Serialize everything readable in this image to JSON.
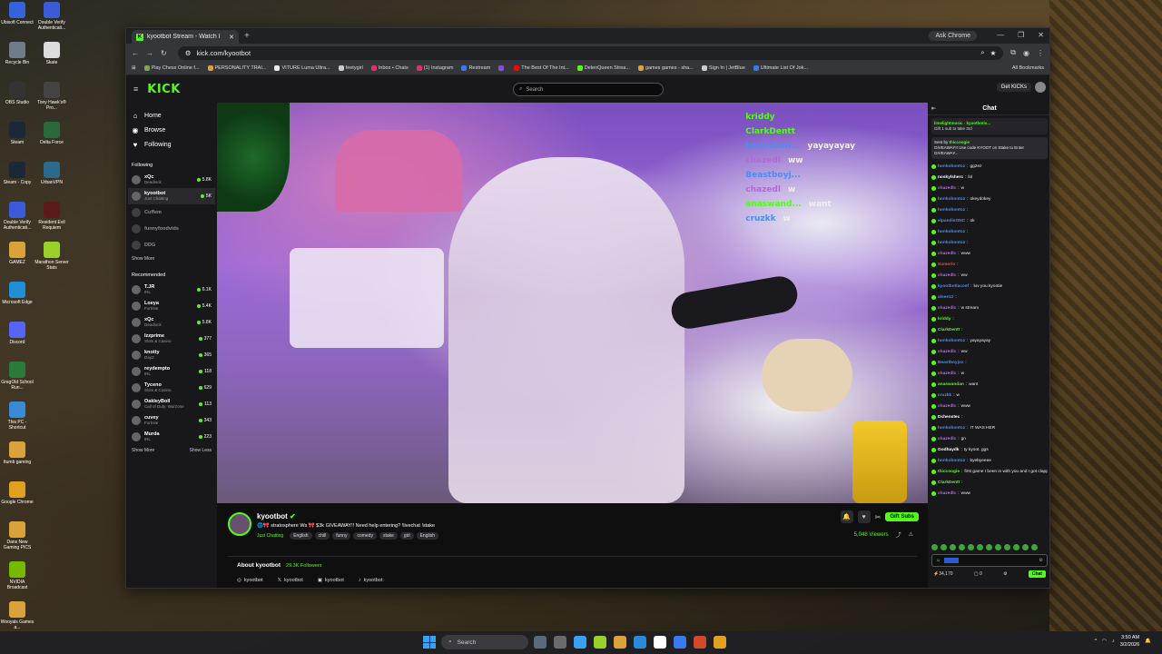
{
  "desktop": {
    "left_icons": [
      {
        "label": "Ubisoft Connect",
        "color": "#3563d9"
      },
      {
        "label": "Recycle Bin",
        "color": "#6f7c8a"
      },
      {
        "label": "OBS Studio",
        "color": "#333333"
      },
      {
        "label": "Steam",
        "color": "#1b2838"
      },
      {
        "label": "Steam - Copy",
        "color": "#1b2838"
      },
      {
        "label": "Double Verify Authenticati...",
        "color": "#3b5bd9"
      },
      {
        "label": "GAMEZ",
        "color": "#d9a23b"
      },
      {
        "label": "Microsoft Edge",
        "color": "#1f8fd8"
      },
      {
        "label": "Discord",
        "color": "#5865f2"
      },
      {
        "label": "GregOld School Run...",
        "color": "#2a7a3a"
      },
      {
        "label": "This PC - Shortcut",
        "color": "#3a8ad8"
      },
      {
        "label": "ttumb gaming",
        "color": "#d9a23b"
      },
      {
        "label": "Google Chrome",
        "color": "#e0a020"
      },
      {
        "label": "Dans New Gaming PICS",
        "color": "#d9a23b"
      },
      {
        "label": "NVIDIA Broadcast",
        "color": "#76b900"
      },
      {
        "label": "Wooyals Games a...",
        "color": "#d9a23b"
      }
    ],
    "right_icons": [
      {
        "label": "Double Verify Authenticati...",
        "color": "#3b5bd9"
      },
      {
        "label": "Skate",
        "color": "#dddddd"
      },
      {
        "label": "Tony Hawk's® Pro...",
        "color": "#444444"
      },
      {
        "label": "Delta Force",
        "color": "#2a6a3a"
      },
      {
        "label": "UrbanVPN",
        "color": "#2a6a8a"
      },
      {
        "label": "Resident Evil Requiem",
        "color": "#5a1a1a"
      },
      {
        "label": "Marathon Server Stats",
        "color": "#9ad02a"
      }
    ]
  },
  "browser": {
    "tab_title": "kyootbot Stream - Watch l",
    "ask_chrome": "Ask Chrome",
    "url": "kick.com/kyootbot",
    "bookmarks": [
      {
        "label": "Play Chess Online f...",
        "color": "#7fa650"
      },
      {
        "label": "PERSONALITY TRAI...",
        "color": "#d9a23b"
      },
      {
        "label": "VITURE Luma Ultra...",
        "color": "#eeeeee"
      },
      {
        "label": "feetygirl",
        "color": "#cccccc"
      },
      {
        "label": "Inbox • Chats",
        "color": "#e1306c"
      },
      {
        "label": "(1) Instagram",
        "color": "#e1306c"
      },
      {
        "label": "Restream",
        "color": "#3a7af0"
      },
      {
        "label": "",
        "color": "#8a4ad8"
      },
      {
        "label": "The Best Of The Int...",
        "color": "#ff0000"
      },
      {
        "label": "DelenQueen Strea...",
        "color": "#53fc18"
      },
      {
        "label": "games games - sha...",
        "color": "#d9a23b"
      },
      {
        "label": "Sign In | JetBlue",
        "color": "#cccccc"
      },
      {
        "label": "Ultimate List Of Jok...",
        "color": "#3a7af0"
      }
    ],
    "all_bookmarks": "All Bookmarks"
  },
  "kick": {
    "logo": "KICK",
    "search_placeholder": "Search",
    "get_kicks": "Get KICKs",
    "nav": [
      {
        "label": "Home",
        "icon": "⌂"
      },
      {
        "label": "Browse",
        "icon": "◉"
      },
      {
        "label": "Following",
        "icon": "♥"
      }
    ],
    "following_title": "Following",
    "following": [
      {
        "name": "xQc",
        "category": "Deadlock",
        "viewers": "5.8K",
        "active": false
      },
      {
        "name": "kyootbot",
        "category": "Just Chatting",
        "viewers": "5K",
        "active": true
      },
      {
        "name": "Cuffem",
        "category": "",
        "viewers": "",
        "active": false
      },
      {
        "name": "funnyfoodvids",
        "category": "",
        "viewers": "",
        "active": false
      },
      {
        "name": "DDG",
        "category": "",
        "viewers": "",
        "active": false
      }
    ],
    "show_more_1": "Show More",
    "recommended_title": "Recommended",
    "recommended": [
      {
        "name": "T.JR",
        "category": "IRL",
        "viewers": "6.1K"
      },
      {
        "name": "Loeya",
        "category": "Fortnite",
        "viewers": "5.4K"
      },
      {
        "name": "xQc",
        "category": "Deadlock",
        "viewers": "5.8K"
      },
      {
        "name": "lzzprime",
        "category": "Slots & Casino",
        "viewers": "377"
      },
      {
        "name": "knotty",
        "category": "DayZ",
        "viewers": "365"
      },
      {
        "name": "reydempto",
        "category": "IRL",
        "viewers": "118"
      },
      {
        "name": "Tyceno",
        "category": "Slots & Casino",
        "viewers": "629"
      },
      {
        "name": "OakleyBoll",
        "category": "Call of Duty: Warzone",
        "viewers": "113"
      },
      {
        "name": "cuvey",
        "category": "Fortnite",
        "viewers": "343"
      },
      {
        "name": "Murda",
        "category": "IRL",
        "viewers": "223"
      }
    ],
    "show_more_2": "Show More",
    "show_less": "Show Less"
  },
  "video_overlay": [
    {
      "user": "kriddy",
      "text": "",
      "color": "#53fc18"
    },
    {
      "user": "ClarkDentt",
      "text": "",
      "color": "#53fc18"
    },
    {
      "user": "honkobon...",
      "text": "yayayayay",
      "color": "#4a8ef0"
    },
    {
      "user": "chazedl",
      "text": "ww",
      "color": "#b06ad8"
    },
    {
      "user": "Beastboyj...",
      "text": "",
      "color": "#4a8ef0"
    },
    {
      "user": "chazedl",
      "text": "w",
      "color": "#b06ad8"
    },
    {
      "user": "anaswand...",
      "text": "want",
      "color": "#53fc18"
    },
    {
      "user": "cruzkk",
      "text": "w",
      "color": "#4a8ef0"
    }
  ],
  "stream": {
    "name": "kyootbot",
    "title": "🌐🎀 stratosphere Ws 🎀 $3k GIVEAWAY!! Need help entering? !livechat !stake",
    "category": "Just Chatting",
    "tags": [
      "English",
      "chill",
      "funny",
      "comedy",
      "stake",
      "girl",
      "English"
    ],
    "gift_subs": "Gift Subs",
    "viewers": "5,048 Viewers",
    "about": "About kyootbot",
    "followers": "29.3K Followers",
    "socials": [
      {
        "icon": "◎",
        "label": "kyootbot"
      },
      {
        "icon": "𝕏",
        "label": "kyootbot"
      },
      {
        "icon": "▣",
        "label": "kyootbot"
      },
      {
        "icon": "♪",
        "label": "kyootbot"
      }
    ]
  },
  "chat": {
    "title": "Chat",
    "pinned_user": "limelightmusic",
    "pinned_user2": "kyootbotis...",
    "pinned_text": "Gift 1 sub to take 3rd",
    "gift_pin_by": "Sent by",
    "gift_pin_user": "thiccoogie",
    "gift_pin_text": "GIVEAWAY!! Use code KYOOT on Stake to Enter GIVEAWAY...",
    "messages": [
      {
        "user": "honkobontoz",
        "text": "gg2ez",
        "color": "#4a8ef0"
      },
      {
        "user": "noskylsherc",
        "text": "lol",
        "color": "#ffffff"
      },
      {
        "user": "chazedlc",
        "text": "w",
        "color": "#b06ad8"
      },
      {
        "user": "honkobontoz",
        "text": "okeydokey",
        "color": "#4a8ef0"
      },
      {
        "user": "honkobontoz",
        "text": "",
        "color": "#4a8ef0"
      },
      {
        "user": "elpandisONC",
        "text": "ok",
        "color": "#4a8ef0"
      },
      {
        "user": "honkobontoz",
        "text": "",
        "color": "#4a8ef0"
      },
      {
        "user": "honkobontoz",
        "text": "",
        "color": "#4a8ef0"
      },
      {
        "user": "chazedlc",
        "text": "www",
        "color": "#b06ad8"
      },
      {
        "user": "Sumerlo",
        "text": "",
        "color": "#e04a4a"
      },
      {
        "user": "chazedlc",
        "text": "ww",
        "color": "#b06ad8"
      },
      {
        "user": "kyootbotlacoef",
        "text": "luv you kyootie",
        "color": "#4a8ef0"
      },
      {
        "user": "alsee12",
        "text": "",
        "color": "#4a8ef0"
      },
      {
        "user": "chazedlc",
        "text": "w stream",
        "color": "#b06ad8"
      },
      {
        "user": "kriddy",
        "text": "",
        "color": "#53fc18"
      },
      {
        "user": "ClarkDentt",
        "text": "",
        "color": "#53fc18"
      },
      {
        "user": "honkobontoz",
        "text": "yayayayay",
        "color": "#4a8ef0"
      },
      {
        "user": "chazedlc",
        "text": "ww",
        "color": "#b06ad8"
      },
      {
        "user": "Beastboyjoz",
        "text": "",
        "color": "#4a8ef0"
      },
      {
        "user": "chazedlc",
        "text": "w",
        "color": "#b06ad8"
      },
      {
        "user": "anaswandan",
        "text": "want",
        "color": "#53fc18"
      },
      {
        "user": "cruzkk",
        "text": "w",
        "color": "#4a8ef0"
      },
      {
        "user": "chazedlc",
        "text": "www",
        "color": "#b06ad8"
      },
      {
        "user": "Dchenstec",
        "text": "",
        "color": "#ffffff"
      },
      {
        "user": "honkobontoz",
        "text": "IT WAS HER",
        "color": "#4a8ef0"
      },
      {
        "user": "chazedlc",
        "text": "gn",
        "color": "#b06ad8"
      },
      {
        "user": "Godhaydk",
        "text": "ty kyoot. ggs",
        "color": "#ffffff"
      },
      {
        "user": "honkobontoz",
        "text": "byebyeeee",
        "color": "#4a8ef0"
      },
      {
        "user": "thiccoogie",
        "text": "first game I been in with you and I got clapped rip",
        "color": "#53fc18"
      },
      {
        "user": "ClarkDentt",
        "text": "",
        "color": "#53fc18"
      },
      {
        "user": "chazedlc",
        "text": "www",
        "color": "#b06ad8"
      }
    ],
    "points": "34,170",
    "count": "0",
    "chat_button": "Chat"
  },
  "taskbar": {
    "search": "Search",
    "time": "3:50 AM",
    "date": "3/2/2026",
    "apps": [
      "#5a6a7a",
      "#6a6a6a",
      "#3aa0f0",
      "#9ad02a",
      "#d9a23b",
      "#2a8ad8",
      "#ffffff",
      "#3a7af0",
      "#d04a2a",
      "#e0a020"
    ]
  }
}
